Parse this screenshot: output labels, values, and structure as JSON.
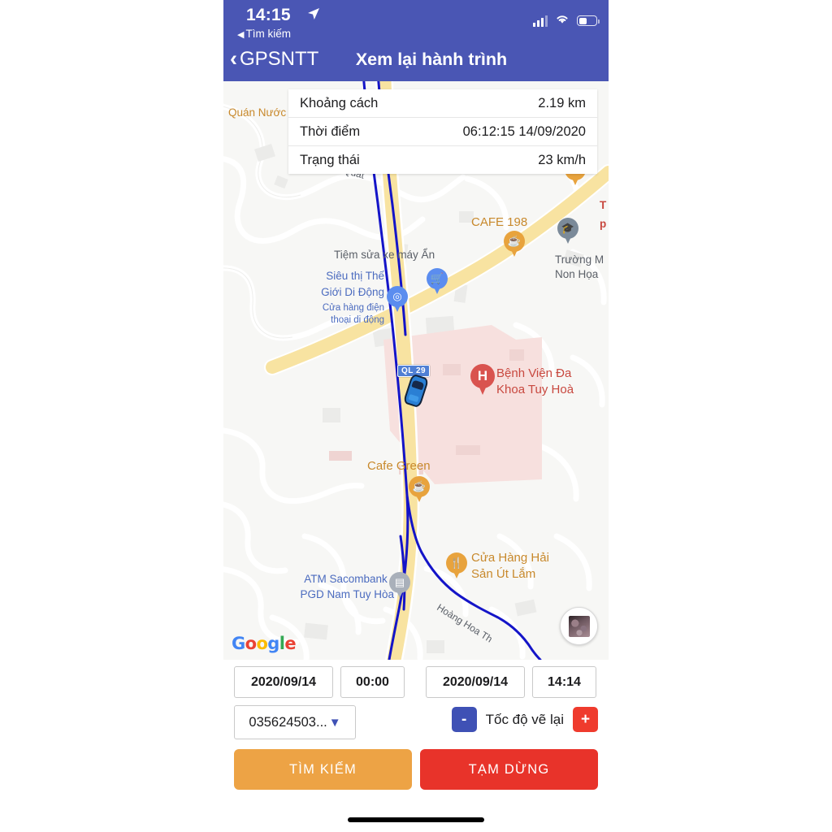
{
  "statusbar": {
    "time": "14:15",
    "location_arrow": "location-arrow-icon",
    "back_app": "Tìm kiếm",
    "back_arrow": "◀",
    "cellular": "cellular-icon",
    "wifi": "wifi-icon",
    "battery": "battery-icon"
  },
  "nav": {
    "back_label": "GPSNTT",
    "chevron": "‹",
    "title": "Xem lại hành trình"
  },
  "info": {
    "rows": [
      {
        "label": "Khoảng cách",
        "value": "2.19 km"
      },
      {
        "label": "Thời điểm",
        "value": "06:12:15 14/09/2020"
      },
      {
        "label": "Trạng thái",
        "value": "23 km/h"
      }
    ]
  },
  "map": {
    "provider": "Google",
    "highway_shield": "QL 29",
    "vehicle": "car-marker",
    "satellite_toggle": "satellite-layer-icon",
    "labels": [
      {
        "text": "Quán Nước",
        "color": "orange"
      },
      {
        "text": "Cao Bá Quát",
        "color": "grey"
      },
      {
        "text": "CAFE 198",
        "color": "orange"
      },
      {
        "text": "Tiệm sửa xe máy Ẩn",
        "color": "grey"
      },
      {
        "text": "Siêu thị Thế",
        "color": "blue"
      },
      {
        "text": "Giới Di Động",
        "color": "blue"
      },
      {
        "text": "Cửa hàng điện",
        "color": "blue"
      },
      {
        "text": "thoại di động",
        "color": "blue"
      },
      {
        "text": "Trường M",
        "color": "grey"
      },
      {
        "text": "Non Họa",
        "color": "grey"
      },
      {
        "text": "T",
        "color": "red"
      },
      {
        "text": "p",
        "color": "red"
      },
      {
        "text": "Bệnh Viện Đa",
        "color": "red"
      },
      {
        "text": "Khoa Tuy Hoà",
        "color": "red"
      },
      {
        "text": "Cafe Green",
        "color": "orange"
      },
      {
        "text": "Cửa Hàng Hải",
        "color": "orange"
      },
      {
        "text": "Sản Út Lắm",
        "color": "orange"
      },
      {
        "text": "ATM Sacombank -",
        "color": "blue"
      },
      {
        "text": "PGD Nam Tuy Hòa",
        "color": "blue"
      },
      {
        "text": "Hoàng Hoa Th",
        "color": "grey"
      }
    ],
    "pins": [
      {
        "name": "shopping-cart-pin",
        "color": "blue"
      },
      {
        "name": "store-pin",
        "color": "blue"
      },
      {
        "name": "coffee-pin-cafe198",
        "color": "orange"
      },
      {
        "name": "graduation-pin",
        "color": "slate"
      },
      {
        "name": "hospital-pin",
        "color": "red",
        "glyph": "H"
      },
      {
        "name": "coffee-pin-cafegreen",
        "color": "orange"
      },
      {
        "name": "restaurant-pin",
        "color": "orange"
      },
      {
        "name": "atm-pin",
        "color": "grey"
      },
      {
        "name": "drop-pin-top",
        "color": "orange"
      }
    ]
  },
  "controls": {
    "date_from": "2020/09/14",
    "time_from": "00:00",
    "date_to": "2020/09/14",
    "time_to": "14:14",
    "device": "035624503...",
    "device_caret": "▼",
    "speed_minus": "-",
    "speed_label": "Tốc độ vẽ lại",
    "speed_plus": "+",
    "search_button": "TÌM KIẾM",
    "pause_button": "TẠM DỪNG"
  },
  "colors": {
    "header": "#4a56b4",
    "route": "#1414c8",
    "road": "#f6e3a4",
    "search": "#eda345",
    "pause": "#e8332a",
    "accent_blue": "#3f51b5"
  }
}
